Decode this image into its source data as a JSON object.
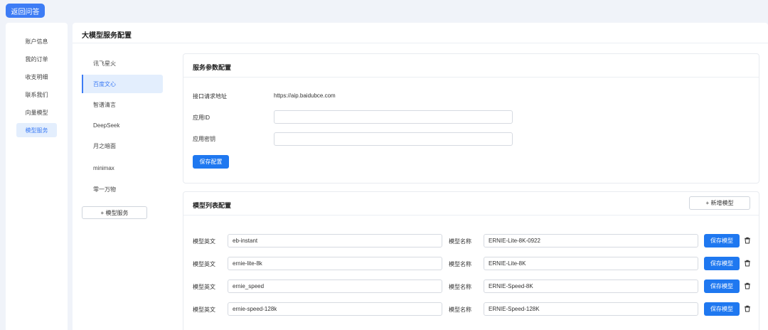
{
  "back_button": "返回问答",
  "sidebar": {
    "items": [
      {
        "label": "账户信息"
      },
      {
        "label": "我的订单"
      },
      {
        "label": "收支明细"
      },
      {
        "label": "联系我们"
      },
      {
        "label": "向量模型"
      },
      {
        "label": "模型服务",
        "active": true
      }
    ]
  },
  "page_title": "大模型服务配置",
  "providers": {
    "items": [
      {
        "label": "讯飞星火"
      },
      {
        "label": "百度文心",
        "active": true
      },
      {
        "label": "智谱清言"
      },
      {
        "label": "DeepSeek"
      },
      {
        "label": "月之暗面"
      },
      {
        "label": "minimax"
      },
      {
        "label": "零一万物"
      }
    ],
    "add_label": "+ 模型服务"
  },
  "service_config": {
    "title": "服务参数配置",
    "endpoint_label": "接口请求地址",
    "endpoint_value": "https://aip.baidubce.com",
    "app_id_label": "应用ID",
    "app_id_value": "",
    "app_secret_label": "应用密钥",
    "app_secret_value": "",
    "save_label": "保存配置"
  },
  "model_list": {
    "title": "模型列表配置",
    "add_label": "+ 新增模型",
    "en_label": "模型英文",
    "name_label": "模型名称",
    "save_label": "保存模型",
    "rows": [
      {
        "model_en": "eb-instant",
        "model_name": "ERNIE-Lite-8K-0922"
      },
      {
        "model_en": "ernie-lite-8k",
        "model_name": "ERNIE-Lite-8K"
      },
      {
        "model_en": "ernie_speed",
        "model_name": "ERNIE-Speed-8K"
      },
      {
        "model_en": "ernie-speed-128k",
        "model_name": "ERNIE-Speed-128K"
      }
    ]
  },
  "colors": {
    "accent": "#1f78f0",
    "active_bg": "#e3eefd",
    "page_bg": "#f0f3f9"
  }
}
